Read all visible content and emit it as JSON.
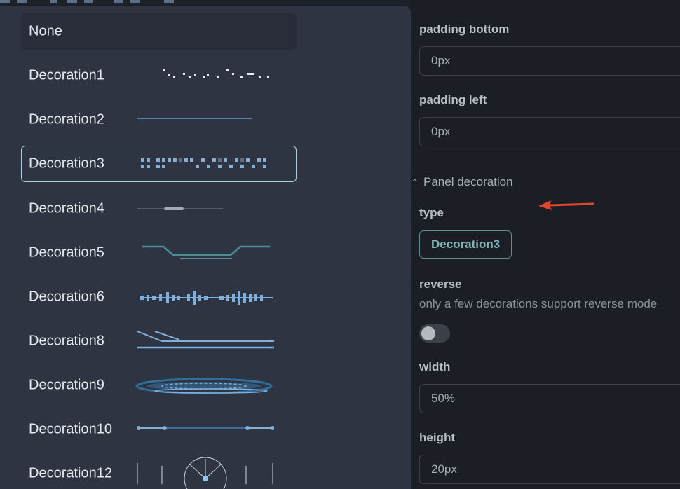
{
  "dropdown": {
    "options": [
      {
        "label": "None"
      },
      {
        "label": "Decoration1"
      },
      {
        "label": "Decoration2"
      },
      {
        "label": "Decoration3"
      },
      {
        "label": "Decoration4"
      },
      {
        "label": "Decoration5"
      },
      {
        "label": "Decoration6"
      },
      {
        "label": "Decoration8"
      },
      {
        "label": "Decoration9"
      },
      {
        "label": "Decoration10"
      },
      {
        "label": "Decoration12"
      }
    ],
    "selected": "Decoration3",
    "hovered": "None"
  },
  "panel": {
    "padding_bottom": {
      "label": "padding bottom",
      "value": "0px"
    },
    "padding_left": {
      "label": "padding left",
      "value": "0px"
    },
    "section_title": "Panel decoration",
    "type": {
      "label": "type",
      "value": "Decoration3"
    },
    "reverse": {
      "label": "reverse",
      "hint": "only a few decorations support reverse mode",
      "enabled": false
    },
    "width": {
      "label": "width",
      "value": "50%"
    },
    "height": {
      "label": "height",
      "value": "20px"
    }
  },
  "colors": {
    "dropdown_bg": "#2f3442",
    "panel_bg": "#1b1e25",
    "accent": "#7fb3b8",
    "arrow": "#e0452e"
  }
}
